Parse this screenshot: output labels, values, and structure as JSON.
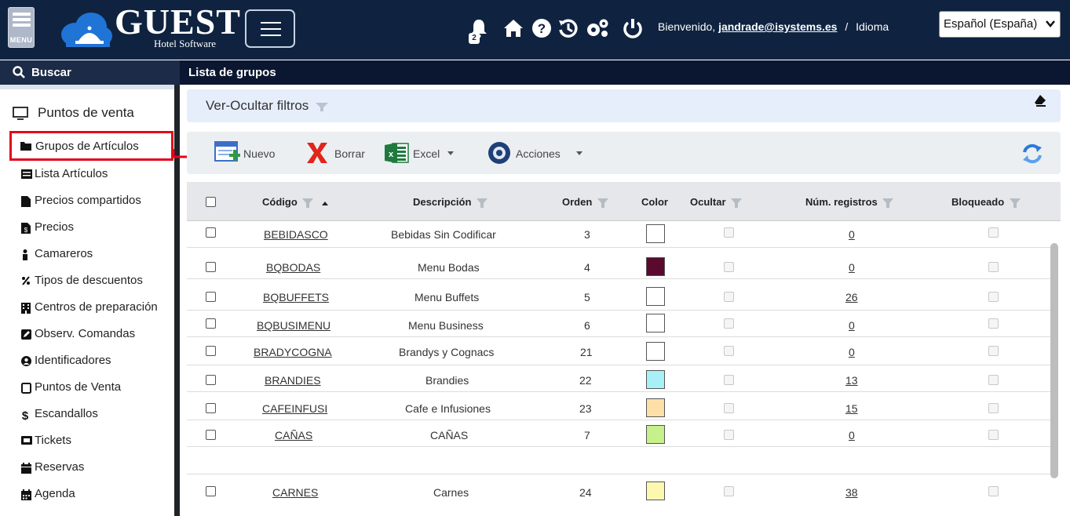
{
  "header": {
    "menu_label": "MENU",
    "logo_title": "GUEST",
    "logo_subtitle": "Hotel Software",
    "notification_count": "2",
    "welcome_text": "Bienvenido,",
    "user_email": "jandrade@isystems.es",
    "separator": "/",
    "language_label": "Idioma",
    "language_value": "Español (España)"
  },
  "subbar": {
    "search_label": "Buscar",
    "page_title": "Lista de grupos"
  },
  "sidebar": {
    "section_title": "Puntos de venta",
    "items": [
      {
        "label": "Grupos de Artículos",
        "icon": "folder-icon"
      },
      {
        "label": "Lista Artículos",
        "icon": "list-icon"
      },
      {
        "label": "Precios compartidos",
        "icon": "file-icon"
      },
      {
        "label": "Precios",
        "icon": "file-invoice-icon"
      },
      {
        "label": "Camareros",
        "icon": "person-icon"
      },
      {
        "label": "Tipos de descuentos",
        "icon": "percent-icon"
      },
      {
        "label": "Centros de preparación",
        "icon": "building-icon"
      },
      {
        "label": "Observ. Comandas",
        "icon": "edit-icon"
      },
      {
        "label": "Identificadores",
        "icon": "user-circle-icon"
      },
      {
        "label": "Puntos de Venta",
        "icon": "tablet-icon"
      },
      {
        "label": "Escandallos",
        "icon": "dollar-icon"
      },
      {
        "label": "Tickets",
        "icon": "ticket-icon"
      },
      {
        "label": "Reservas",
        "icon": "calendar-icon"
      },
      {
        "label": "Agenda",
        "icon": "calendar-grid-icon"
      }
    ]
  },
  "filters": {
    "toggle_label": "Ver-Ocultar filtros"
  },
  "toolbar": {
    "new_label": "Nuevo",
    "delete_label": "Borrar",
    "excel_label": "Excel",
    "actions_label": "Acciones"
  },
  "table": {
    "columns": {
      "code": "Código",
      "description": "Descripción",
      "order": "Orden",
      "color": "Color",
      "hide": "Ocultar",
      "records": "Núm. registros",
      "locked": "Bloqueado"
    },
    "rows": [
      {
        "code": "BEBIDASCO",
        "description": "Bebidas Sin Codificar",
        "order": "3",
        "color": "#ffffff",
        "records": "0"
      },
      {
        "code": "BQBODAS",
        "description": "Menu Bodas",
        "order": "4",
        "color": "#5a0a2e",
        "records": "0"
      },
      {
        "code": "BQBUFFETS",
        "description": "Menu Buffets",
        "order": "5",
        "color": "#ffffff",
        "records": "26"
      },
      {
        "code": "BQBUSIMENU",
        "description": "Menu Business",
        "order": "6",
        "color": "#ffffff",
        "records": "0"
      },
      {
        "code": "BRADYCOGNA",
        "description": "Brandys y Cognacs",
        "order": "21",
        "color": "#ffffff",
        "records": "0"
      },
      {
        "code": "BRANDIES",
        "description": "Brandies",
        "order": "22",
        "color": "#a8f0f8",
        "records": "13"
      },
      {
        "code": "CAFEINFUSI",
        "description": "Cafe e Infusiones",
        "order": "23",
        "color": "#fde0a8",
        "records": "15"
      },
      {
        "code": "CAÑAS",
        "description": "CAÑAS",
        "order": "7",
        "color": "#c6f08a",
        "records": "0"
      },
      {
        "code": "CARNES",
        "description": "Carnes",
        "order": "24",
        "color": "#fdf8b0",
        "records": "38"
      }
    ]
  }
}
